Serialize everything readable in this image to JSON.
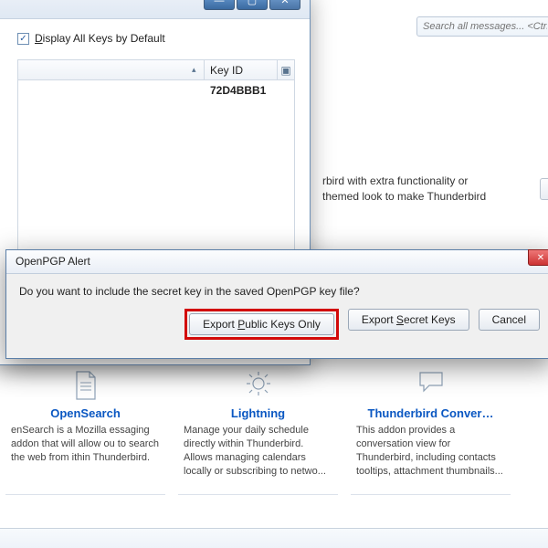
{
  "search": {
    "placeholder": "Search all messages... <Ctrl+"
  },
  "page_blurb": {
    "line1": "rbird with extra functionality or",
    "line2": "themed look to make Thunderbird"
  },
  "keymgr": {
    "checkbox_label_pre": "D",
    "checkbox_label_mid": "isplay All Keys by Default",
    "col_name": "",
    "col_keyid": "Key ID",
    "row_keyid": "72D4BBB1"
  },
  "dialog": {
    "title": "OpenPGP Alert",
    "message": "Do you want to include the secret key in the saved OpenPGP key file?",
    "buttons": {
      "export_public_pre": "Export ",
      "export_public_u": "P",
      "export_public_post": "ublic Keys Only",
      "export_secret_pre": "Export ",
      "export_secret_u": "S",
      "export_secret_post": "ecret Keys",
      "cancel": "Cancel"
    }
  },
  "addons": [
    {
      "title": "OpenSearch",
      "desc": "enSearch is a Mozilla essaging addon that will allow ou to search the web from ithin Thunderbird."
    },
    {
      "title": "Lightning",
      "desc": "Manage your daily schedule directly within Thunderbird. Allows managing calendars locally or subscribing to netwo..."
    },
    {
      "title": "Thunderbird Conver…",
      "desc": "This addon provides a conversation view for Thunderbird, including contacts tooltips, attachment thumbnails..."
    }
  ]
}
